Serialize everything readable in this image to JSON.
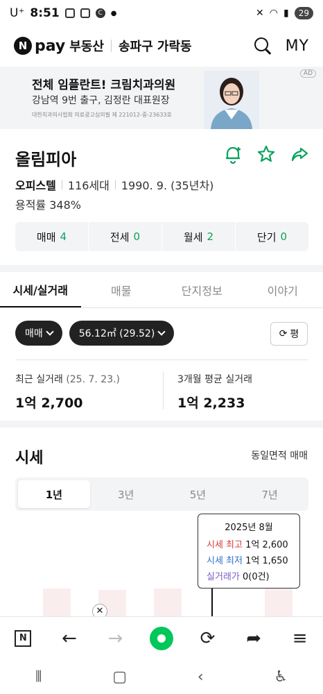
{
  "status_bar": {
    "carrier": "U⁺",
    "time": "8:51",
    "battery": "29"
  },
  "header": {
    "logo_n": "N",
    "logo_pay": "pay",
    "brand": "부동산",
    "region": "송파구 가락동",
    "my_label": "MY"
  },
  "ad": {
    "title": "전체 임플란트! 크림치과의원",
    "subtitle": "강남역 9번 출구, 김정란 대표원장",
    "fine_print": "대한치과의사협회 의료광고심의필 제 221012-중-23633호",
    "badge": "AD"
  },
  "complex": {
    "name": "올림피아",
    "type": "오피스텔",
    "households": "116세대",
    "built": "1990. 9. (35년차)",
    "floor_area_ratio": "용적률 348%"
  },
  "trade_counts": [
    {
      "label": "매매",
      "count": "4"
    },
    {
      "label": "전세",
      "count": "0"
    },
    {
      "label": "월세",
      "count": "2"
    },
    {
      "label": "단기",
      "count": "0"
    }
  ],
  "tabs": [
    {
      "label": "시세/실거래",
      "active": true
    },
    {
      "label": "매물",
      "active": false
    },
    {
      "label": "단지정보",
      "active": false
    },
    {
      "label": "이야기",
      "active": false
    }
  ],
  "filters": {
    "deal_type": "매매",
    "area": "56.12㎡ (29.52)",
    "pyeong_button": "평"
  },
  "recent_deal": {
    "label": "최근 실거래",
    "date": "(25. 7. 23.)",
    "value": "1억 2,700"
  },
  "avg_deal": {
    "label": "3개월 평균 실거래",
    "value": "1억 2,233"
  },
  "price_section": {
    "title": "시세",
    "same_area_label": "동일면적 매매"
  },
  "periods": [
    {
      "label": "1년",
      "active": true
    },
    {
      "label": "3년",
      "active": false
    },
    {
      "label": "5년",
      "active": false
    },
    {
      "label": "7년",
      "active": false
    }
  ],
  "tooltip": {
    "month": "2025년 8월",
    "high_label": "시세 최고",
    "high_value": "1억 2,600",
    "low_label": "시세 최저",
    "low_value": "1억 1,650",
    "deal_label": "실거래가",
    "deal_value": "0(0건)"
  },
  "browser_bar": {
    "n_label": "N"
  },
  "colors": {
    "accent_green": "#03c75a",
    "count_green": "#0aa35b",
    "high_red": "#d83a3a",
    "low_blue": "#2f6fd1",
    "deal_purple": "#7a5cc5"
  }
}
